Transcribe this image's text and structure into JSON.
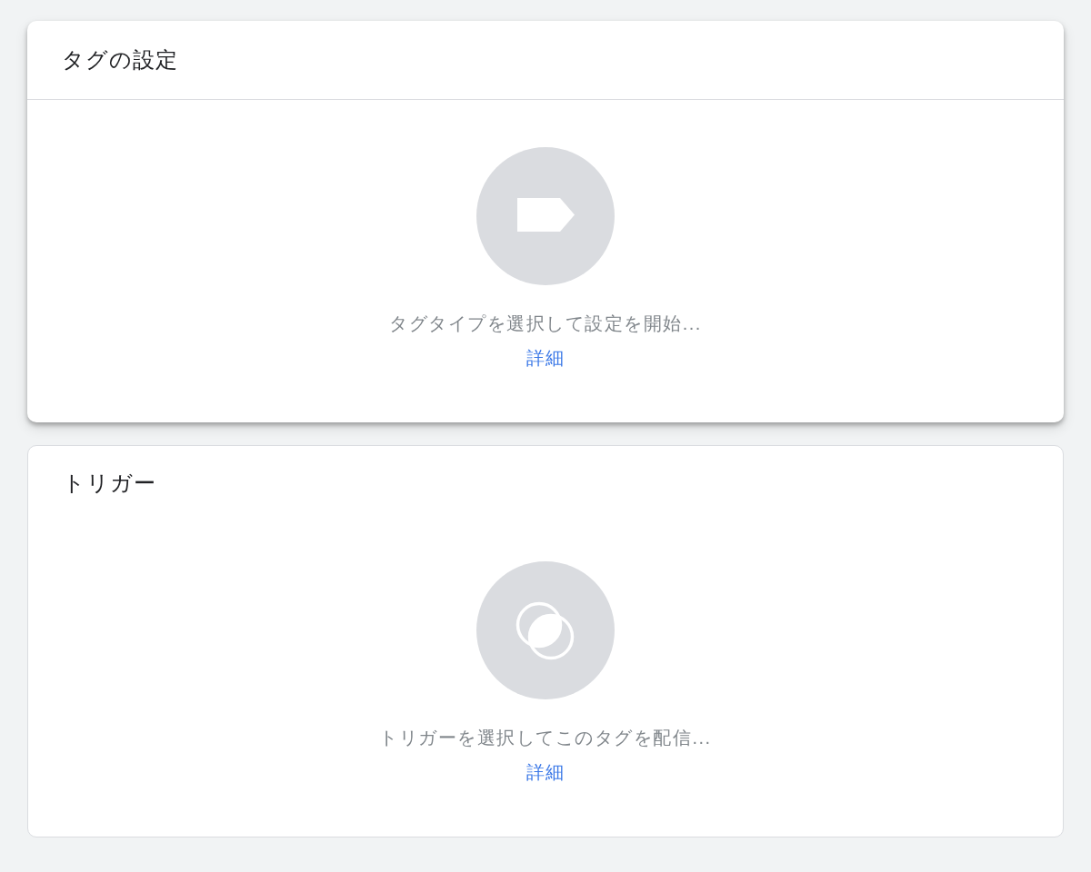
{
  "cards": [
    {
      "kind": "tag",
      "elevated": true,
      "title": "タグの設定",
      "message": "タグタイプを選択して設定を開始...",
      "link": "詳細"
    },
    {
      "kind": "trigger",
      "elevated": false,
      "title": "トリガー",
      "message": "トリガーを選択してこのタグを配信...",
      "link": "詳細"
    }
  ]
}
